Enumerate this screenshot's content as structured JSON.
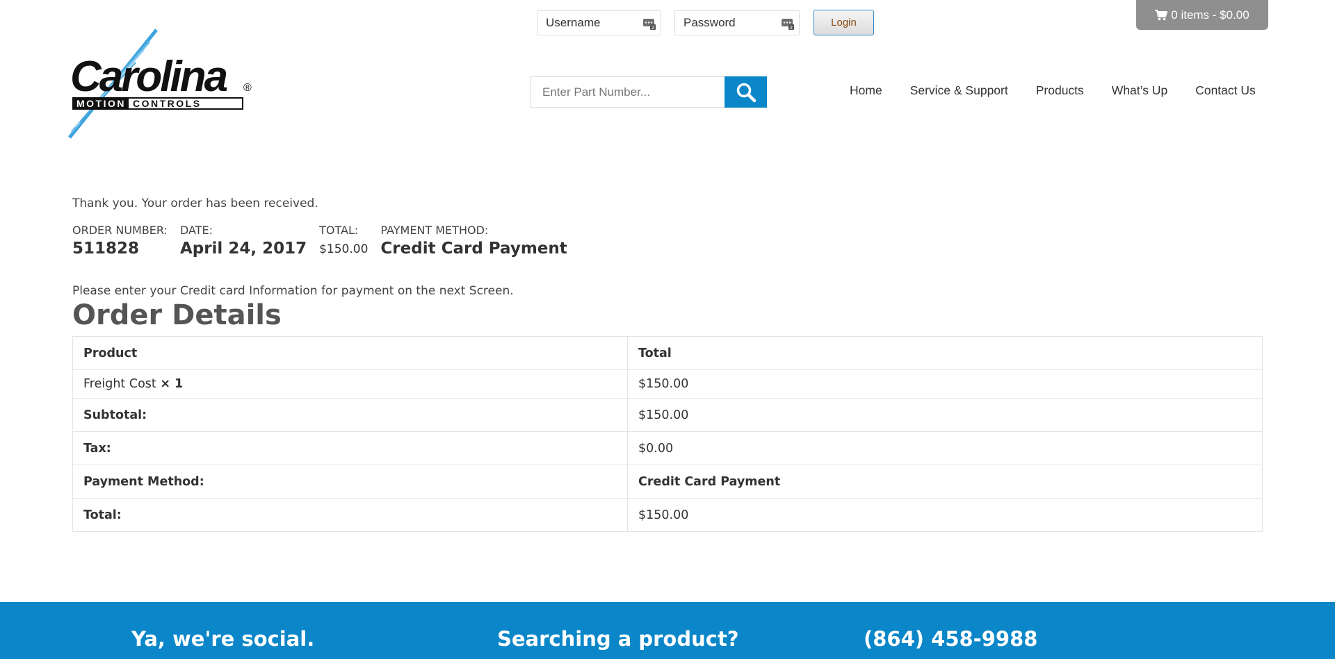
{
  "header": {
    "username_placeholder": "Username",
    "password_placeholder": "Password",
    "login_label": "Login",
    "cart_label": "0 items - $0.00",
    "search_placeholder": "Enter Part Number...",
    "logo": {
      "word": "Carolina",
      "reg": "®",
      "sub1": "MOTION",
      "sub2": "CONTROLS"
    },
    "nav": [
      "Home",
      "Service & Support",
      "Products",
      "What’s Up",
      "Contact Us"
    ]
  },
  "order": {
    "thanks": "Thank you. Your order has been received.",
    "overview": [
      {
        "label": "ORDER NUMBER:",
        "value": "511828"
      },
      {
        "label": "DATE:",
        "value": "April 24, 2017"
      },
      {
        "label": "TOTAL:",
        "value": "$150.00"
      },
      {
        "label": "PAYMENT METHOD:",
        "value": "Credit Card Payment"
      }
    ],
    "cc_note": "Please enter your Credit card Information for payment on the next Screen.",
    "details_title": "Order Details",
    "table": {
      "head": [
        "Product",
        "Total"
      ],
      "item": {
        "name": "Freight Cost",
        "qty": "× 1",
        "total": "$150.00"
      },
      "rows": [
        {
          "label": "Subtotal:",
          "value": "$150.00"
        },
        {
          "label": "Tax:",
          "value": "$0.00"
        },
        {
          "label": "Payment Method:",
          "value": "Credit Card Payment"
        },
        {
          "label": "Total:",
          "value": "$150.00"
        }
      ]
    }
  },
  "footer": {
    "social": "Ya, we're social.",
    "search": "Searching a product?",
    "phone": "(864) 458-9988"
  },
  "colors": {
    "accent": "#0a86c9",
    "cart_bg": "#8f8f8f"
  }
}
